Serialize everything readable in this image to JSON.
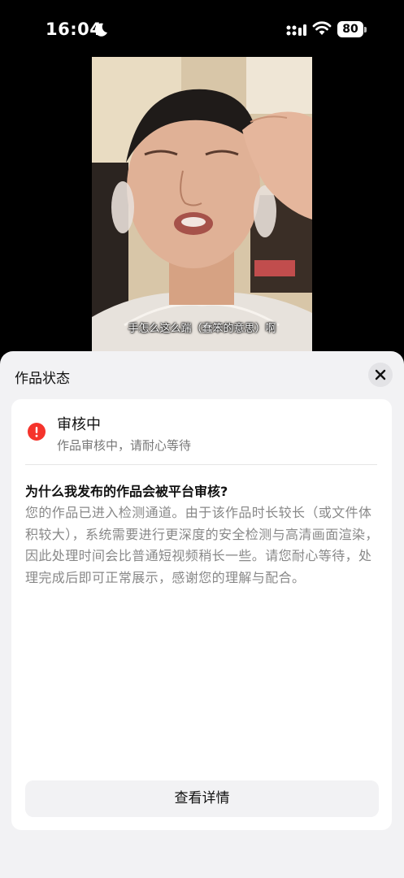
{
  "status_bar": {
    "time": "16:04",
    "battery": "80",
    "icons": [
      "moon-icon",
      "signal-icon",
      "wifi-icon",
      "battery-icon"
    ]
  },
  "video": {
    "subtitle": "手怎么这么踹（蠢笨的意思）啊"
  },
  "sheet": {
    "title": "作品状态",
    "close_icon": "close-icon",
    "status": {
      "icon": "exclamation-icon",
      "icon_color": "#f5342c",
      "title": "审核中",
      "description": "作品审核中，请耐心等待"
    },
    "faq": {
      "question": "为什么我发布的作品会被平台审核?",
      "answer": "您的作品已进入检测通道。由于该作品时长较长（或文件体积较大），系统需要进行更深度的安全检测与高清画面渲染，因此处理时间会比普通短视频稍长一些。请您耐心等待，处理完成后即可正常展示，感谢您的理解与配合。"
    },
    "details_button": "查看详情"
  }
}
